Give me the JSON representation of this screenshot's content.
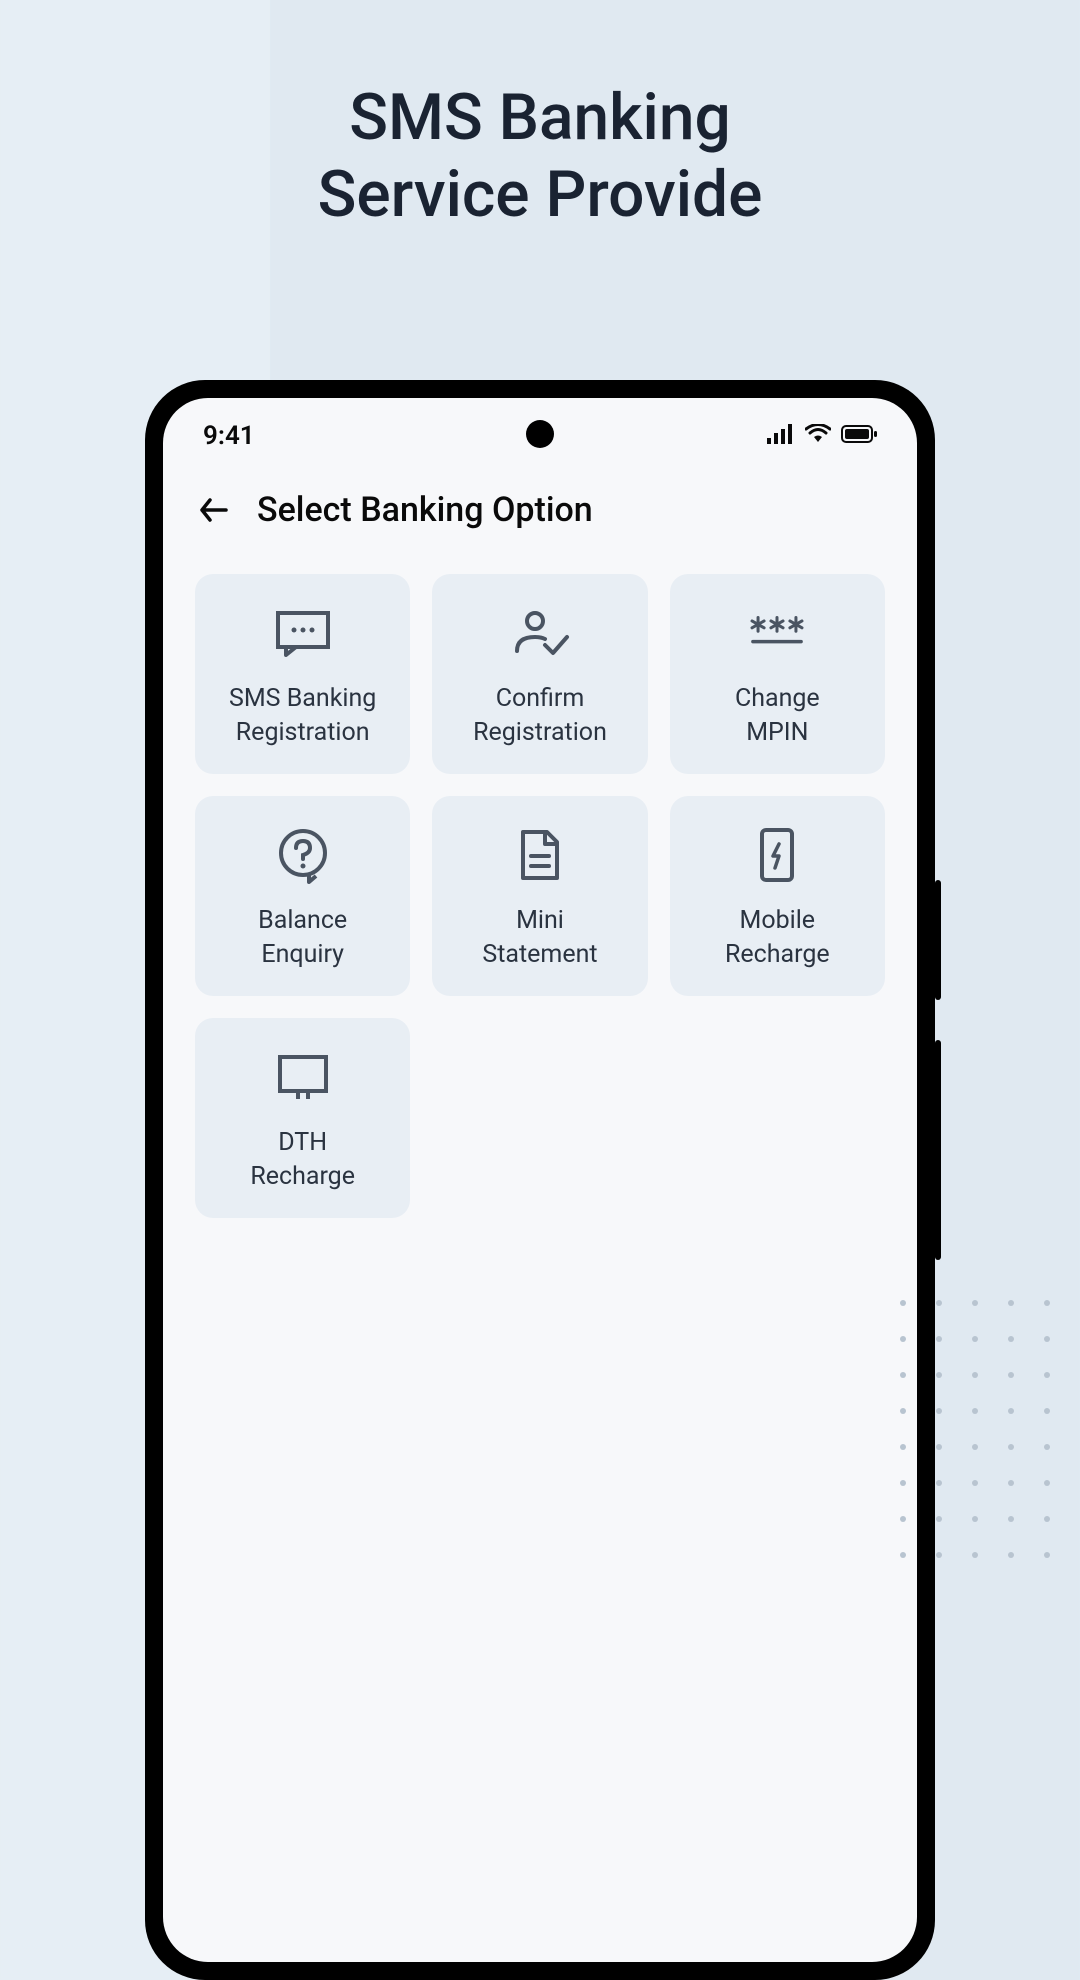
{
  "promo": {
    "line1": "SMS Banking",
    "line2": "Service Provide"
  },
  "status": {
    "time": "9:41"
  },
  "header": {
    "title": "Select Banking Option"
  },
  "options": [
    {
      "id": "sms-banking-registration",
      "label": "SMS Banking\nRegistration",
      "icon": "message"
    },
    {
      "id": "confirm-registration",
      "label": "Confirm\nRegistration",
      "icon": "user-check"
    },
    {
      "id": "change-mpin",
      "label": "Change\nMPIN",
      "icon": "asterisks"
    },
    {
      "id": "balance-enquiry",
      "label": "Balance\nEnquiry",
      "icon": "question-circle"
    },
    {
      "id": "mini-statement",
      "label": "Mini\nStatement",
      "icon": "document"
    },
    {
      "id": "mobile-recharge",
      "label": "Mobile\nRecharge",
      "icon": "phone-charge"
    },
    {
      "id": "dth-recharge",
      "label": "DTH\nRecharge",
      "icon": "monitor"
    }
  ],
  "colors": {
    "iconStroke": "#4a5462",
    "cardBg": "#e8eef4",
    "textDark": "#1a2332"
  }
}
